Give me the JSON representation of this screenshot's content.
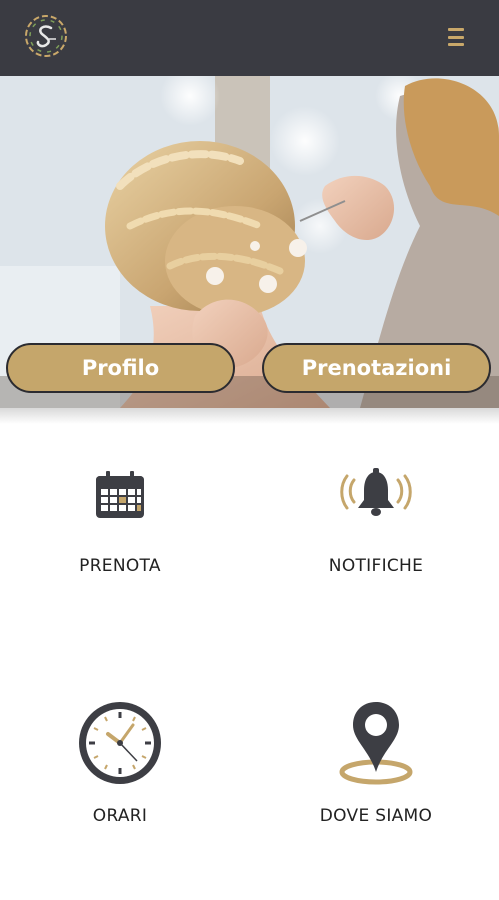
{
  "header": {
    "logo_icon": "salon-logo-icon",
    "menu_icon": "hamburger-menu-icon",
    "accent": "#c9a86a",
    "background": "#3a3b42"
  },
  "hero": {
    "image": "hairdresser-braided-updo-photo",
    "buttons": [
      {
        "label": "Profilo"
      },
      {
        "label": "Prenotazioni"
      }
    ]
  },
  "tiles": [
    {
      "label": "PRENOTA",
      "icon": "calendar-icon"
    },
    {
      "label": "NOTIFICHE",
      "icon": "bell-icon"
    },
    {
      "label": "ORARI",
      "icon": "clock-icon"
    },
    {
      "label": "DOVE SIAMO",
      "icon": "map-pin-icon"
    }
  ],
  "colors": {
    "gold": "#c5a66b",
    "dark": "#3a3b42"
  }
}
